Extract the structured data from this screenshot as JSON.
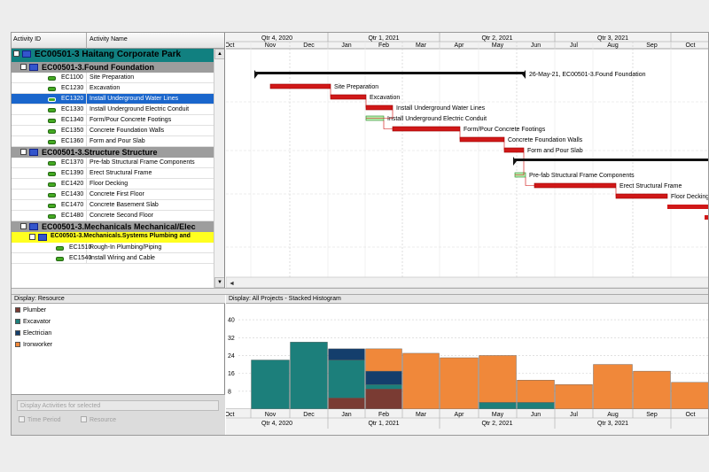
{
  "activity_table": {
    "col_id": "Activity ID",
    "col_name": "Activity Name",
    "project": {
      "label": "EC00501-3  Haitang Corporate Park"
    },
    "groups": [
      {
        "label": "EC00501-3.Found  Foundation",
        "activities": [
          {
            "id": "EC1100",
            "name": "Site Preparation"
          },
          {
            "id": "EC1230",
            "name": "Excavation"
          },
          {
            "id": "EC1320",
            "name": "Install Underground Water Lines",
            "selected": true
          },
          {
            "id": "EC1330",
            "name": "Install Underground Electric Conduit"
          },
          {
            "id": "EC1340",
            "name": "Form/Pour Concrete Footings"
          },
          {
            "id": "EC1350",
            "name": "Concrete Foundation Walls"
          },
          {
            "id": "EC1360",
            "name": "Form and Pour Slab"
          }
        ]
      },
      {
        "label": "EC00501-3.Structure  Structure",
        "activities": [
          {
            "id": "EC1370",
            "name": "Pre-fab Structural Frame Components"
          },
          {
            "id": "EC1390",
            "name": "Erect Structural Frame"
          },
          {
            "id": "EC1420",
            "name": "Floor Decking"
          },
          {
            "id": "EC1430",
            "name": "Concrete First Floor"
          },
          {
            "id": "EC1470",
            "name": "Concrete Basement Slab"
          },
          {
            "id": "EC1480",
            "name": "Concrete Second Floor"
          }
        ]
      },
      {
        "label": "EC00501-3.Mechanicals  Mechanical/Elec",
        "activities": []
      }
    ],
    "subgroup": {
      "label": "EC00501-3.Mechanicals.Systems  Plumbing and",
      "activities": [
        {
          "id": "EC1510",
          "name": "Rough-In Plumbing/Piping"
        },
        {
          "id": "EC1540",
          "name": "Install Wiring and Cable"
        }
      ]
    }
  },
  "timescale": {
    "quarters": [
      "Qtr 4, 2020",
      "Qtr 1, 2021",
      "Qtr 2, 2021",
      "Qtr 3, 2021"
    ],
    "months": [
      "Oct",
      "Nov",
      "Dec",
      "Jan",
      "Feb",
      "Mar",
      "Apr",
      "May",
      "Jun",
      "Jul",
      "Aug",
      "Sep",
      "Oct"
    ]
  },
  "gantt": {
    "summary_label": "26-May-21, EC00501-3.Found  Foundation",
    "bar_labels": [
      "Site Preparation",
      "Excavation",
      "Install Underground Water Lines",
      "Install Underground Electric Conduit",
      "Form/Pour Concrete Footings",
      "Concrete Foundation Walls",
      "Form and Pour Slab",
      "Pre-fab Structural Frame Components",
      "Erect Structural Frame",
      "Floor Decking"
    ]
  },
  "resource_panel": {
    "title": "Display: Resource",
    "resources": [
      {
        "name": "Plumber",
        "color": "#7a3b33"
      },
      {
        "name": "Excavator",
        "color": "#1c7f7b"
      },
      {
        "name": "Electrician",
        "color": "#143e6c"
      },
      {
        "name": "Ironworker",
        "color": "#f0883a"
      }
    ],
    "button": "Display Activities for selected",
    "check_time": "Time Period",
    "check_resource": "Resource"
  },
  "histogram_panel": {
    "title": "Display: All Projects - Stacked Histogram"
  },
  "chart_data": {
    "type": "bar",
    "stacked": true,
    "categories": [
      "Oct",
      "Nov",
      "Dec",
      "Jan",
      "Feb",
      "Mar",
      "Apr",
      "May",
      "Jun",
      "Jul",
      "Aug",
      "Sep",
      "Oct"
    ],
    "yticks": [
      8,
      16,
      24,
      32,
      40
    ],
    "ylim": [
      0,
      44
    ],
    "series": [
      {
        "name": "Plumber",
        "color": "#7a3b33",
        "values": [
          0,
          0,
          0,
          5,
          9,
          0,
          0,
          0,
          0,
          0,
          0,
          0,
          0
        ]
      },
      {
        "name": "Excavator",
        "color": "#1c7f7b",
        "values": [
          0,
          22,
          30,
          17,
          2,
          0,
          0,
          3,
          3,
          0,
          0,
          0,
          0
        ]
      },
      {
        "name": "Electrician",
        "color": "#143e6c",
        "values": [
          0,
          0,
          0,
          5,
          6,
          0,
          0,
          0,
          0,
          0,
          0,
          0,
          0
        ]
      },
      {
        "name": "Ironworker",
        "color": "#f0883a",
        "values": [
          0,
          0,
          0,
          0,
          10,
          25,
          23,
          21,
          10,
          11,
          20,
          17,
          12
        ]
      }
    ],
    "quarters": [
      "Qtr 4, 2020",
      "Qtr 1, 2021",
      "Qtr 2, 2021",
      "Qtr 3, 2021"
    ]
  }
}
